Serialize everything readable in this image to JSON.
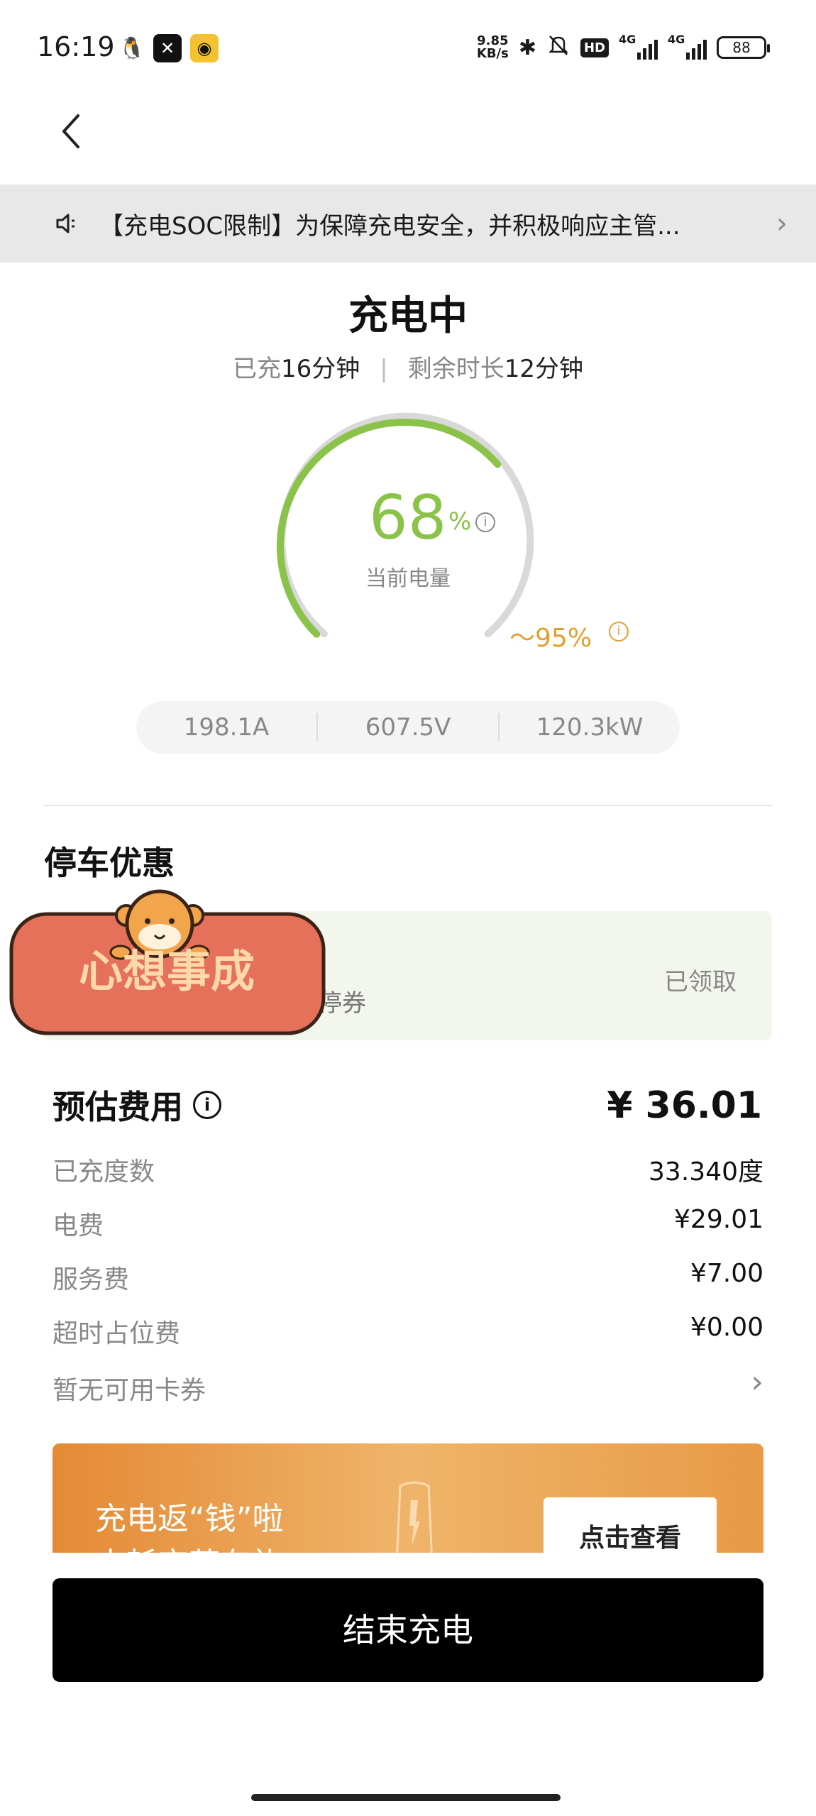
{
  "status_bar": {
    "time": "16:19",
    "speed_value": "9.85",
    "speed_unit": "KB/s",
    "hd_label": "HD",
    "signal1_label": "4G",
    "signal2_label": "4G",
    "battery_level": "88"
  },
  "notice": {
    "text": "【充电SOC限制】为保障充电安全，并积极响应主管..."
  },
  "charging": {
    "status": "充电中",
    "charged_label": "已充",
    "charged_value": "16分钟",
    "remaining_label": "剩余时长",
    "remaining_value": "12分钟",
    "soc_value": "68",
    "soc_unit": "%",
    "soc_label": "当前电量",
    "soc_fraction": 0.68,
    "target": "95%",
    "current": "198.1A",
    "voltage": "607.5V",
    "power": "120.3kW"
  },
  "parking": {
    "title": "停车优惠",
    "description": "时免停券",
    "status": "已领取",
    "sticker_text": "心想事成"
  },
  "fees": {
    "title": "预估费用",
    "total": "¥ 36.01",
    "rows": [
      {
        "label": "已充度数",
        "value": "33.340度"
      },
      {
        "label": "电费",
        "value": "¥29.01"
      },
      {
        "label": "服务费",
        "value": "¥7.00"
      },
      {
        "label": "超时占位费",
        "value": "¥0.00"
      }
    ],
    "coupon_label": "暂无可用卡券"
  },
  "banner": {
    "line1": "充电返“钱”啦",
    "line2": "电耗宝营有礼",
    "button": "点击查看"
  },
  "actions": {
    "end_charging": "结束充电"
  },
  "colors": {
    "gauge_green": "#8bc34a",
    "target_orange": "#e0a030",
    "banner_orange": "#e48a35",
    "end_button": "#000000"
  }
}
